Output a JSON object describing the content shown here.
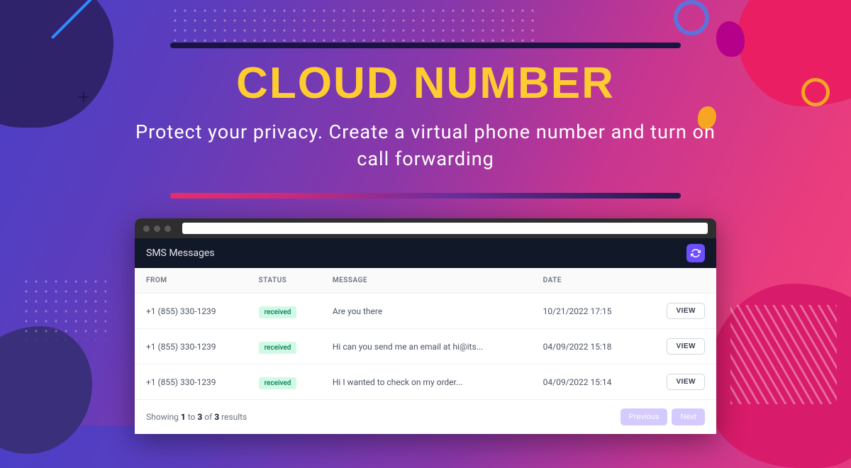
{
  "hero": {
    "title": "CLOUD NUMBER",
    "subtitle": "Protect your privacy. Create a virtual phone number and turn on call forwarding"
  },
  "panel": {
    "title": "SMS Messages",
    "columns": {
      "from": "FROM",
      "status": "STATUS",
      "message": "MESSAGE",
      "date": "DATE"
    },
    "rows": [
      {
        "from": "+1 (855) 330-1239",
        "status": "received",
        "message": "Are you there",
        "date": "10/21/2022 17:15",
        "action": "VIEW"
      },
      {
        "from": "+1 (855) 330-1239",
        "status": "received",
        "message": "Hi can you send me an email at hi@its...",
        "date": "04/09/2022 15:18",
        "action": "VIEW"
      },
      {
        "from": "+1 (855) 330-1239",
        "status": "received",
        "message": "Hi I wanted to check on my order...",
        "date": "04/09/2022 15:14",
        "action": "VIEW"
      }
    ],
    "pager": {
      "prefix": "Showing ",
      "from": "1",
      "mid1": " to ",
      "to": "3",
      "mid2": " of ",
      "total": "3",
      "suffix": " results",
      "prev": "Previous",
      "next": "Next"
    }
  }
}
